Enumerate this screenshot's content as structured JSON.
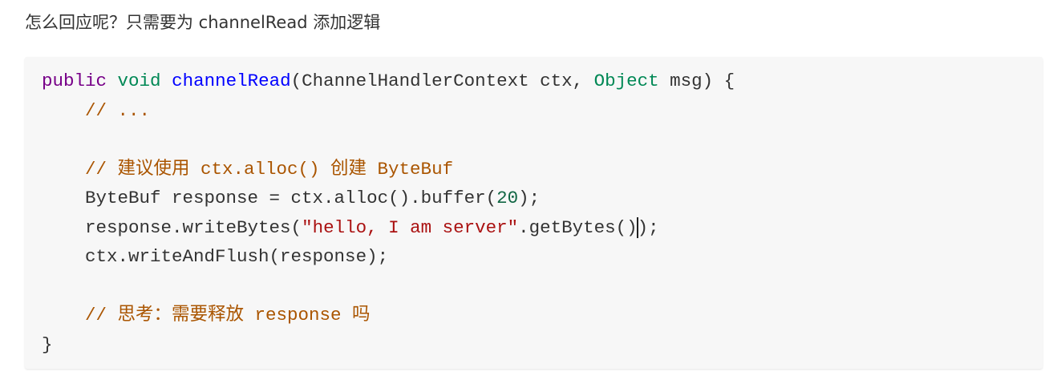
{
  "title": "怎么回应呢？只需要为 channelRead 添加逻辑",
  "colors": {
    "keyword": "#770088",
    "type": "#008855",
    "def": "#0000ff",
    "comment": "#aa5500",
    "string": "#aa1111",
    "number": "#116644",
    "plain": "#333333"
  },
  "code_lines": [
    [
      {
        "t": "public",
        "c": "keyword"
      },
      {
        "t": " "
      },
      {
        "t": "void",
        "c": "type"
      },
      {
        "t": " "
      },
      {
        "t": "channelRead",
        "c": "def"
      },
      {
        "t": "(ChannelHandlerContext ctx, "
      },
      {
        "t": "Object",
        "c": "type"
      },
      {
        "t": " msg) {"
      }
    ],
    [
      {
        "t": "    "
      },
      {
        "t": "// ...",
        "c": "comment"
      }
    ],
    [],
    [
      {
        "t": "    "
      },
      {
        "t": "// 建议使用 ctx.alloc() 创建 ByteBuf",
        "c": "comment"
      }
    ],
    [
      {
        "t": "    ByteBuf response = ctx.alloc().buffer("
      },
      {
        "t": "20",
        "c": "number"
      },
      {
        "t": ");"
      }
    ],
    [
      {
        "t": "    response.writeBytes("
      },
      {
        "t": "\"hello, I am server\"",
        "c": "string"
      },
      {
        "t": ".getBytes()"
      },
      {
        "t": "",
        "caret": true
      },
      {
        "t": ");"
      }
    ],
    [
      {
        "t": "    ctx.writeAndFlush(response);"
      }
    ],
    [],
    [
      {
        "t": "    "
      },
      {
        "t": "// 思考：需要释放 response 吗",
        "c": "comment"
      }
    ],
    [
      {
        "t": "}"
      }
    ]
  ]
}
